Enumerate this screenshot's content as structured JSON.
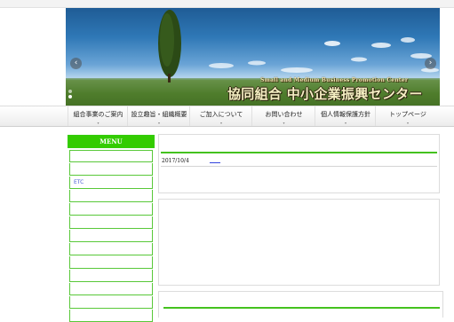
{
  "hero": {
    "title_en": "Small and Medium Business Promotion Center",
    "title_jp": "協同組合 中小企業振興センター",
    "prev_label": "‹",
    "next_label": "›"
  },
  "nav": [
    {
      "label": "組合事業のご案内"
    },
    {
      "label": "設立趣旨・組織概要"
    },
    {
      "label": "ご加入について"
    },
    {
      "label": "お問い合わせ"
    },
    {
      "label": "個人情報保護方針"
    },
    {
      "label": "トップページ"
    }
  ],
  "nav_caret": "▾",
  "sidebar": {
    "header": "MENU",
    "items": [
      "",
      "",
      "ETC",
      "",
      "",
      "",
      "",
      "",
      "",
      "",
      "",
      "",
      ""
    ]
  },
  "news": {
    "date": "2017/10/4",
    "link": "____"
  },
  "colors": {
    "accent_green": "#33cc00",
    "link_blue": "#3344dd"
  }
}
